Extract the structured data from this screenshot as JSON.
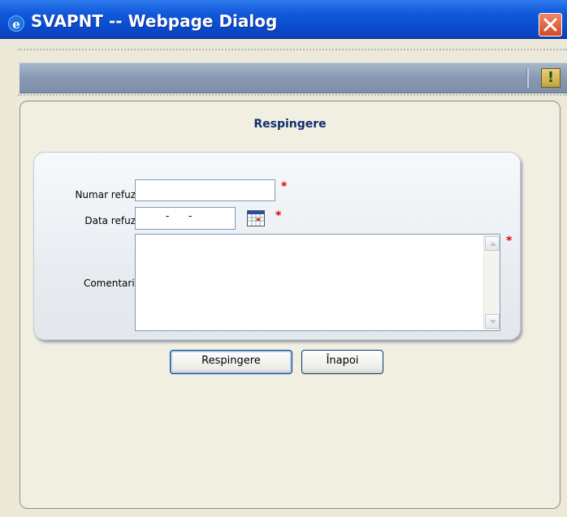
{
  "window": {
    "title": "SVAPNT -- Webpage Dialog",
    "icon": "ie-icon",
    "close_icon": "close-icon"
  },
  "toolbar": {
    "alert_icon": "alert-icon",
    "alert_glyph": "!"
  },
  "page": {
    "title": "Respingere"
  },
  "form": {
    "numar_refuz": {
      "label": "Numar refuz",
      "value": "",
      "required_mark": "*"
    },
    "data_refuz": {
      "label": "Data refuz",
      "value": "",
      "separators": [
        "-",
        "-"
      ],
      "required_mark": "*",
      "calendar_icon": "calendar-icon"
    },
    "comentarii": {
      "label": "Comentarii",
      "value": "",
      "required_mark": "*"
    }
  },
  "actions": {
    "reject_label": "Respingere",
    "back_label": "Înapoi"
  },
  "colors": {
    "title_bar": "#0a4cd0",
    "toolbar": "#8899b3",
    "required": "#e00000",
    "page_title": "#0e2f6c"
  }
}
